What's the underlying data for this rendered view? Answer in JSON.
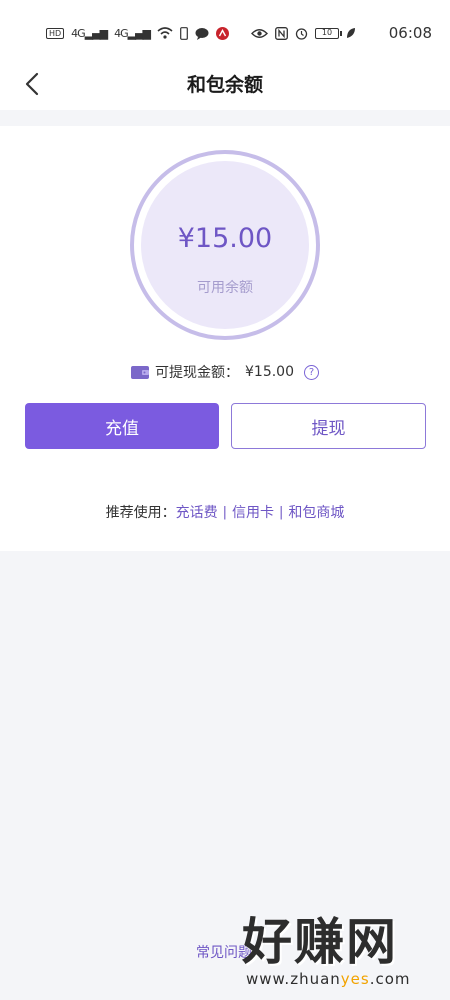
{
  "status_bar": {
    "network_label": "HD",
    "signal1": "4G",
    "signal2": "4G",
    "battery": "10",
    "time": "06:08"
  },
  "nav": {
    "title": "和包余额"
  },
  "balance": {
    "amount": "¥15.00",
    "label": "可用余额"
  },
  "withdrawable": {
    "label": "可提现金额：",
    "amount": "¥15.00",
    "help": "?"
  },
  "actions": {
    "recharge_label": "充值",
    "withdraw_label": "提现"
  },
  "recommend": {
    "prefix": "推荐使用：",
    "links": [
      "充话费",
      "信用卡",
      "和包商城"
    ]
  },
  "footer": {
    "faq_label": "常见问题"
  },
  "watermark": {
    "main": "好赚网",
    "url_prefix": "www.zhuan",
    "url_accent": "yes",
    "url_suffix": ".com"
  },
  "colors": {
    "accent": "#7b5be0",
    "ring": "#c6bde9",
    "ring_fill": "#ece8f9",
    "page_bg": "#f4f5f8"
  }
}
